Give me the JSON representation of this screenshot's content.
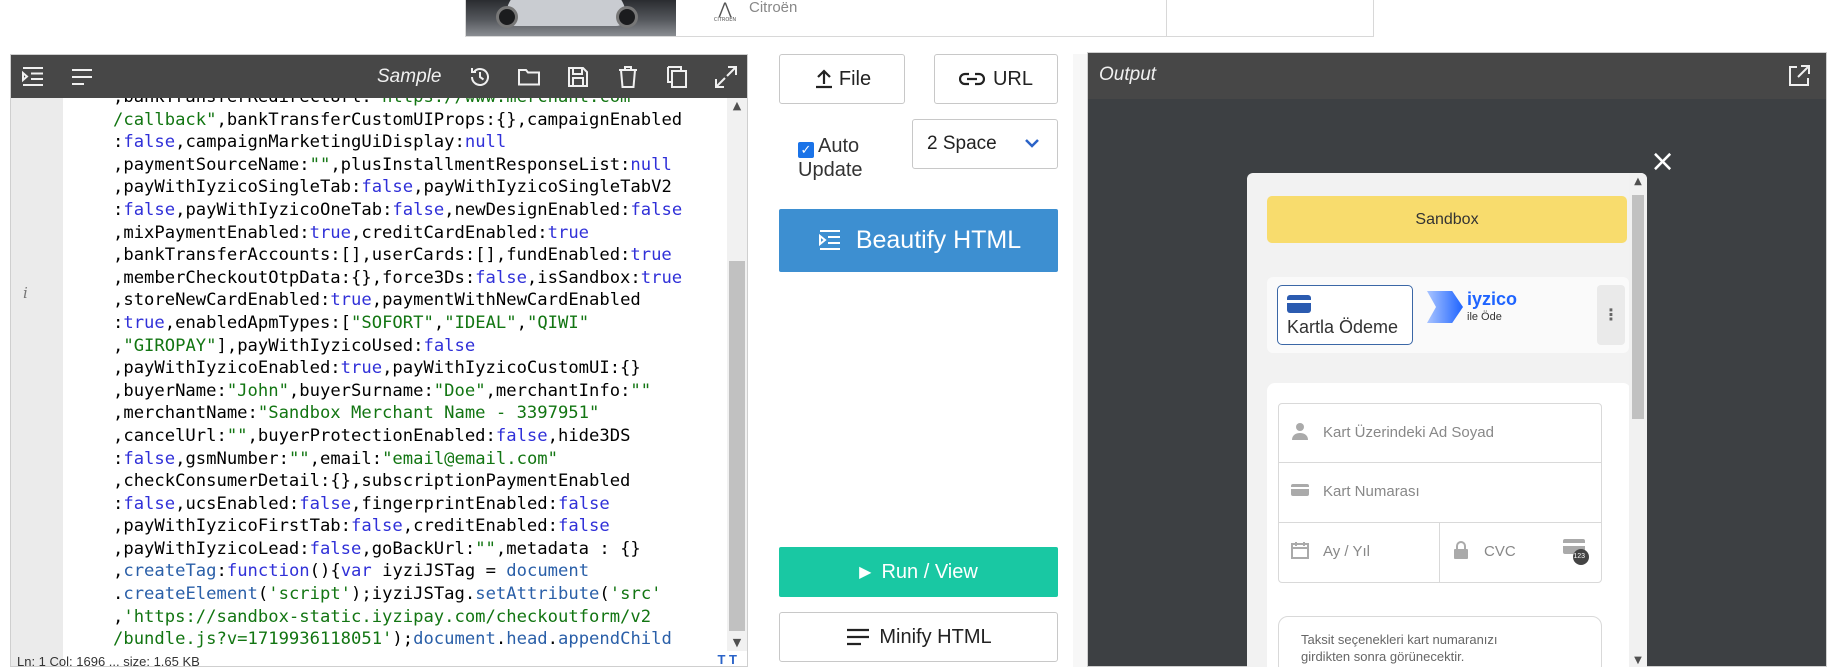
{
  "ad": {
    "brand": "Citroën",
    "logo_sub": "CITROËN"
  },
  "editor": {
    "sample_label": "Sample",
    "gutter_info": "i",
    "status_text": "Ln: 1 Col: 1696  ...  size: 1.65 KB",
    "status_icon": "T T",
    "lines": [
      [
        [
          "p",
          ",bankTransferRedirectUrl:"
        ],
        [
          "s",
          "\"https://www.merchant.com"
        ]
      ],
      [
        [
          "s",
          "/callback\""
        ],
        [
          "p",
          ",bankTransferCustomUIProps:{},campaignEnabled"
        ]
      ],
      [
        [
          "p",
          ":"
        ],
        [
          "k",
          "false"
        ],
        [
          "p",
          ",campaignMarketingUiDisplay:"
        ],
        [
          "k",
          "null"
        ]
      ],
      [
        [
          "p",
          ",paymentSourceName:"
        ],
        [
          "s",
          "\"\""
        ],
        [
          "p",
          ",plusInstallmentResponseList:"
        ],
        [
          "k",
          "null"
        ]
      ],
      [
        [
          "p",
          ",payWithIyzicoSingleTab:"
        ],
        [
          "k",
          "false"
        ],
        [
          "p",
          ",payWithIyzicoSingleTabV2"
        ]
      ],
      [
        [
          "p",
          ":"
        ],
        [
          "k",
          "false"
        ],
        [
          "p",
          ",payWithIyzicoOneTab:"
        ],
        [
          "k",
          "false"
        ],
        [
          "p",
          ",newDesignEnabled:"
        ],
        [
          "k",
          "false"
        ]
      ],
      [
        [
          "p",
          ",mixPaymentEnabled:"
        ],
        [
          "k",
          "true"
        ],
        [
          "p",
          ",creditCardEnabled:"
        ],
        [
          "k",
          "true"
        ]
      ],
      [
        [
          "p",
          ",bankTransferAccounts:[],userCards:[],fundEnabled:"
        ],
        [
          "k",
          "true"
        ]
      ],
      [
        [
          "p",
          ",memberCheckoutOtpData:{},force3Ds:"
        ],
        [
          "k",
          "false"
        ],
        [
          "p",
          ",isSandbox:"
        ],
        [
          "k",
          "true"
        ]
      ],
      [
        [
          "p",
          ",storeNewCardEnabled:"
        ],
        [
          "k",
          "true"
        ],
        [
          "p",
          ",paymentWithNewCardEnabled"
        ]
      ],
      [
        [
          "p",
          ":"
        ],
        [
          "k",
          "true"
        ],
        [
          "p",
          ",enabledApmTypes:["
        ],
        [
          "s",
          "\"SOFORT\""
        ],
        [
          "p",
          ","
        ],
        [
          "s",
          "\"IDEAL\""
        ],
        [
          "p",
          ","
        ],
        [
          "s",
          "\"QIWI\""
        ]
      ],
      [
        [
          "p",
          ","
        ],
        [
          "s",
          "\"GIROPAY\""
        ],
        [
          "p",
          "],payWithIyzicoUsed:"
        ],
        [
          "k",
          "false"
        ]
      ],
      [
        [
          "p",
          ",payWithIyzicoEnabled:"
        ],
        [
          "k",
          "true"
        ],
        [
          "p",
          ",payWithIyzicoCustomUI:{}"
        ]
      ],
      [
        [
          "p",
          ",buyerName:"
        ],
        [
          "s",
          "\"John\""
        ],
        [
          "p",
          ",buyerSurname:"
        ],
        [
          "s",
          "\"Doe\""
        ],
        [
          "p",
          ",merchantInfo:"
        ],
        [
          "s",
          "\"\""
        ]
      ],
      [
        [
          "p",
          ",merchantName:"
        ],
        [
          "s",
          "\"Sandbox Merchant Name - 3397951\""
        ]
      ],
      [
        [
          "p",
          ",cancelUrl:"
        ],
        [
          "s",
          "\"\""
        ],
        [
          "p",
          ",buyerProtectionEnabled:"
        ],
        [
          "k",
          "false"
        ],
        [
          "p",
          ",hide3DS"
        ]
      ],
      [
        [
          "p",
          ":"
        ],
        [
          "k",
          "false"
        ],
        [
          "p",
          ",gsmNumber:"
        ],
        [
          "s",
          "\"\""
        ],
        [
          "p",
          ",email:"
        ],
        [
          "s",
          "\"email@email.com\""
        ]
      ],
      [
        [
          "p",
          ",checkConsumerDetail:{},subscriptionPaymentEnabled"
        ]
      ],
      [
        [
          "p",
          ":"
        ],
        [
          "k",
          "false"
        ],
        [
          "p",
          ",ucsEnabled:"
        ],
        [
          "k",
          "false"
        ],
        [
          "p",
          ",fingerprintEnabled:"
        ],
        [
          "k",
          "false"
        ]
      ],
      [
        [
          "p",
          ",payWithIyzicoFirstTab:"
        ],
        [
          "k",
          "false"
        ],
        [
          "p",
          ",creditEnabled:"
        ],
        [
          "k",
          "false"
        ]
      ],
      [
        [
          "p",
          ",payWithIyzicoLead:"
        ],
        [
          "k",
          "false"
        ],
        [
          "p",
          ",goBackUrl:"
        ],
        [
          "s",
          "\"\""
        ],
        [
          "p",
          ",metadata : {}"
        ]
      ],
      [
        [
          "p",
          ","
        ],
        [
          "f",
          "createTag"
        ],
        [
          "p",
          ":"
        ],
        [
          "k",
          "function"
        ],
        [
          "p",
          "(){"
        ],
        [
          "k",
          "var"
        ],
        [
          "p",
          " iyziJSTag = "
        ],
        [
          "f",
          "document"
        ]
      ],
      [
        [
          "p",
          "."
        ],
        [
          "f",
          "createElement"
        ],
        [
          "p",
          "("
        ],
        [
          "s",
          "'script'"
        ],
        [
          "p",
          ");iyziJSTag."
        ],
        [
          "f",
          "setAttribute"
        ],
        [
          "p",
          "("
        ],
        [
          "s",
          "'src'"
        ]
      ],
      [
        [
          "p",
          ","
        ],
        [
          "s",
          "'https://sandbox-static.iyzipay.com/checkoutform/v2"
        ]
      ],
      [
        [
          "s",
          "/bundle.js?v=1719936118051'"
        ],
        [
          "p",
          ");"
        ],
        [
          "f",
          "document"
        ],
        [
          "p",
          "."
        ],
        [
          "f",
          "head"
        ],
        [
          "p",
          "."
        ],
        [
          "f",
          "appendChild"
        ]
      ]
    ]
  },
  "middle": {
    "file_label": "File",
    "url_label": "URL",
    "auto_update_label_1": "Auto",
    "auto_update_label_2": "Update",
    "auto_update_checked": true,
    "indent_selected": "2 Space",
    "beautify_label": "Beautify HTML",
    "run_label": "Run / View",
    "minify_label": "Minify HTML"
  },
  "output": {
    "title": "Output",
    "close_glyph": "×",
    "sandbox_banner": "Sandbox",
    "tab_card_label": "Kartla Ödeme",
    "iyzico_name": "iyzico",
    "iyzico_sub": "ile Öde",
    "more_glyph": "⋮",
    "name_placeholder": "Kart Üzerindeki Ad Soyad",
    "number_placeholder": "Kart Numarası",
    "expiry_placeholder": "Ay / Yıl",
    "cvc_placeholder": "CVC",
    "cvc_badge": "123",
    "taksit_line1": "Taksit seçenekleri kart numaranızı",
    "taksit_line2": "girdikten sonra görünecektir."
  },
  "colors": {
    "toolbar": "#474747",
    "beautify": "#3d8fd1",
    "run": "#19c8a3",
    "sandbox": "#f8dc6d",
    "keyword": "#3030d8",
    "string": "#127512",
    "iyzico": "#1e64ff"
  }
}
